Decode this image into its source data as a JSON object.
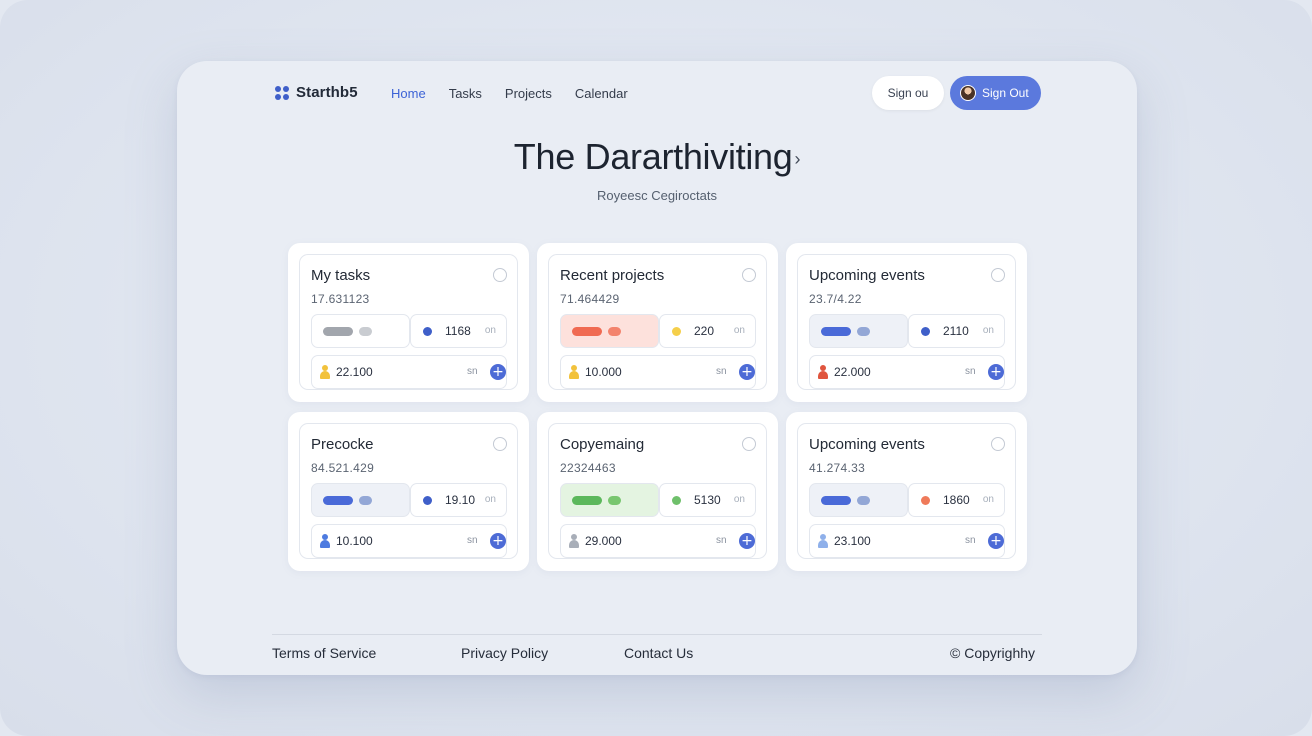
{
  "brand": {
    "name": "Starthb5",
    "logo_icon": "grid-dots-icon",
    "color": "#3f5fc9"
  },
  "nav": [
    {
      "label": "Home",
      "active": true
    },
    {
      "label": "Tasks",
      "active": false
    },
    {
      "label": "Projects",
      "active": false
    },
    {
      "label": "Calendar",
      "active": false
    }
  ],
  "header": {
    "signin_label": "Sign ou",
    "signout_label": "Sign Out",
    "accent": "#5b79dd"
  },
  "hero": {
    "title": "The Dararthiviting",
    "title_chevron": "›",
    "subtitle": "Royeesc Cegiroctats"
  },
  "cards": [
    {
      "title": "My tasks",
      "value": "17.631123",
      "pill_bg": "#ffffff",
      "bar_color": "#a2a6ad",
      "bar_dot_color": "#c9ccd1",
      "metric_dot": "#3f5fc9",
      "metric": "1168",
      "metric_unit": "on",
      "person_color": "#f2c23c",
      "footer_value": "22.100",
      "footer_unit": "sn"
    },
    {
      "title": "Recent projects",
      "value": "71.464429",
      "pill_bg": "#fde1dc",
      "bar_color": "#f06a52",
      "bar_dot_color": "#f3836d",
      "metric_dot": "#f5cf4a",
      "metric": "220",
      "metric_unit": "on",
      "person_color": "#f2c23c",
      "footer_value": "10.000",
      "footer_unit": "sn"
    },
    {
      "title": "Upcoming events",
      "value": "23.7/4.22",
      "pill_bg": "#eef1f7",
      "bar_color": "#4a6ad8",
      "bar_dot_color": "#93a7d6",
      "metric_dot": "#3f5fc9",
      "metric": "2110",
      "metric_unit": "on",
      "person_color": "#e0553e",
      "footer_value": "22.000",
      "footer_unit": "sn"
    },
    {
      "title": "Precocke",
      "value": "84.521.429",
      "pill_bg": "#eef1f7",
      "bar_color": "#4a6ad8",
      "bar_dot_color": "#93a7d6",
      "metric_dot": "#3f5fc9",
      "metric": "19.10",
      "metric_unit": "on",
      "person_color": "#4d7be0",
      "footer_value": "10.100",
      "footer_unit": "sn"
    },
    {
      "title": "Copyemaing",
      "value": "22324463",
      "pill_bg": "#e4f4e1",
      "bar_color": "#5cb85c",
      "bar_dot_color": "#78c66f",
      "metric_dot": "#6fc06b",
      "metric": "5130",
      "metric_unit": "on",
      "person_color": "#a8aeb8",
      "footer_value": "29.000",
      "footer_unit": "sn"
    },
    {
      "title": "Upcoming events",
      "value": "41.274.33",
      "pill_bg": "#eef1f7",
      "bar_color": "#4a6ad8",
      "bar_dot_color": "#93a7d6",
      "metric_dot": "#ef7a5a",
      "metric": "1860",
      "metric_unit": "on",
      "person_color": "#8fb0ea",
      "footer_value": "23.100",
      "footer_unit": "sn"
    }
  ],
  "footer": {
    "terms": "Terms of Service",
    "privacy": "Privacy Policy",
    "contact": "Contact Us",
    "copyright": "© Copyrighhy"
  }
}
